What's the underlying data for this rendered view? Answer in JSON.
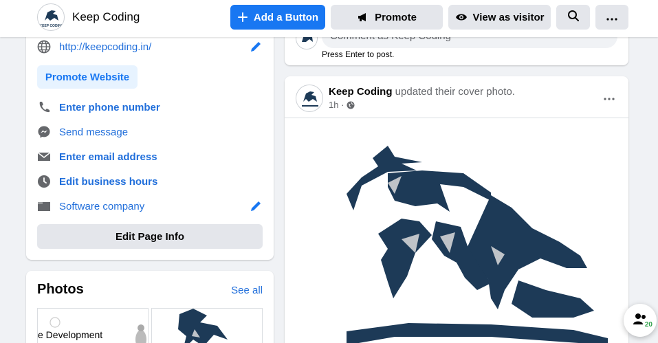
{
  "header": {
    "page_name": "Keep Coding",
    "logo_text": "KEEP CODING",
    "add_button": "Add a Button",
    "promote_button": "Promote",
    "view_as_visitor": "View as visitor"
  },
  "intro": {
    "website": "http://keepcoding.in/",
    "promote_website": "Promote Website",
    "phone": "Enter phone number",
    "message": "Send message",
    "email": "Enter email address",
    "hours": "Edit business hours",
    "category": "Software company",
    "edit_page_info": "Edit Page Info"
  },
  "photos": {
    "title": "Photos",
    "see_all": "See all",
    "thumb1_caption": "e Development"
  },
  "comment": {
    "placeholder": "Comment as Keep Coding",
    "hint": "Press Enter to post."
  },
  "post": {
    "author": "Keep Coding",
    "action": " updated their cover photo.",
    "time": "1h ·"
  },
  "contacts": {
    "count": "20"
  },
  "colors": {
    "accent": "#1877f2",
    "link": "#216fdb",
    "horse": "#1d3a57"
  },
  "icons": [
    "plus-icon",
    "megaphone-icon",
    "eye-icon",
    "search-icon",
    "more-icon",
    "globe-icon",
    "pencil-icon",
    "phone-icon",
    "messenger-icon",
    "mail-icon",
    "clock-icon",
    "briefcase-icon",
    "contacts-icon"
  ]
}
